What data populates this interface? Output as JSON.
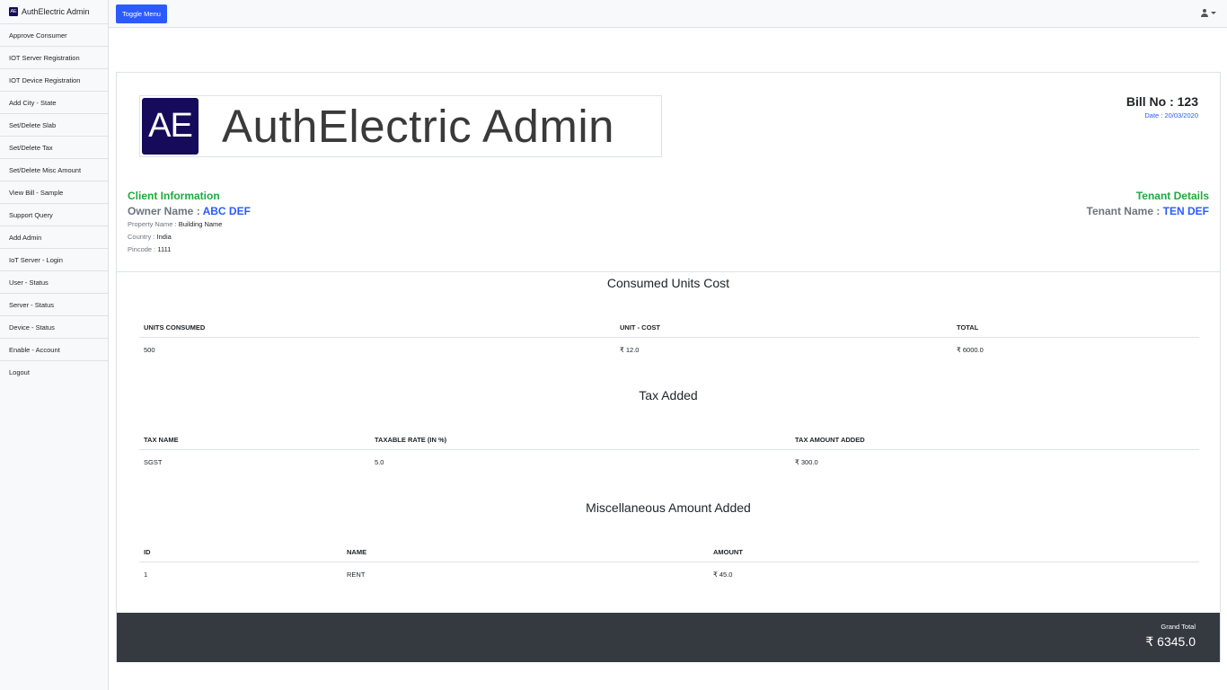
{
  "sidebar": {
    "brand_logo": "AE",
    "brand": "AuthElectric Admin",
    "items": [
      "Approve Consumer",
      "IOT Server Registration",
      "IOT Device Registration",
      "Add City - State",
      "Set/Delete Slab",
      "Set/Delete Tax",
      "Set/Delete Misc Amount",
      "View Bill - Sample",
      "Support Query",
      "Add Admin",
      "IoT Server - Login",
      "User - Status",
      "Server - Status",
      "Device - Status",
      "Enable - Account",
      "Logout"
    ]
  },
  "topbar": {
    "toggle_label": "Toggle Menu",
    "user_icon": "user-icon"
  },
  "bill": {
    "logo_mark": "AE",
    "logo_text": "AuthElectric Admin",
    "bill_no": "Bill No : 123",
    "date": "Date : 20/03/2020",
    "client": {
      "title": "Client Information",
      "owner_label": "Owner Name : ",
      "owner_value": "ABC DEF",
      "property_label": "Property Name : ",
      "property_value": "Building Name",
      "country_label": "Country : ",
      "country_value": "India",
      "pincode_label": "Pincode : ",
      "pincode_value": "1111"
    },
    "tenant": {
      "title": "Tenant Details",
      "name_label": "Tenant Name : ",
      "name_value": "TEN DEF"
    },
    "consumed": {
      "title": "Consumed Units Cost",
      "headers": [
        "UNITS CONSUMED",
        "UNIT - COST",
        "TOTAL"
      ],
      "rows": [
        [
          "500",
          "₹ 12.0",
          "₹ 6000.0"
        ]
      ]
    },
    "tax": {
      "title": "Tax Added",
      "headers": [
        "TAX NAME",
        "TAXABLE RATE (IN %)",
        "TAX AMOUNT ADDED"
      ],
      "rows": [
        [
          "SGST",
          "5.0",
          "₹ 300.0"
        ]
      ]
    },
    "misc": {
      "title": "Miscellaneous Amount Added",
      "headers": [
        "ID",
        "NAME",
        "AMOUNT"
      ],
      "rows": [
        [
          "1",
          "RENT",
          "₹ 45.0"
        ]
      ]
    },
    "grand_total_label": "Grand Total",
    "grand_total_value": "₹ 6345.0"
  },
  "colors": {
    "primary": "#2b5bff",
    "green": "#1faa3e",
    "footer": "#343a40",
    "logo_bg": "#150b5a"
  }
}
